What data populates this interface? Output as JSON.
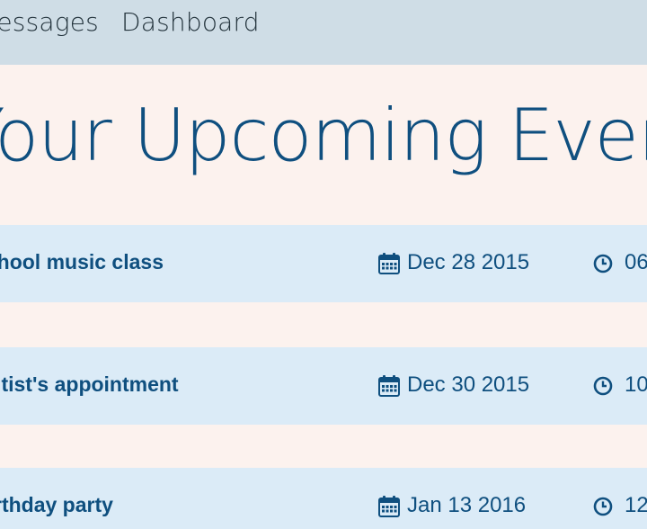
{
  "nav": {
    "messages_label": "Messages",
    "dashboard_label": "Dashboard"
  },
  "heading": "Your Upcoming Events",
  "events": [
    {
      "title": "After school music class",
      "date": "Dec 28 2015",
      "time": "06"
    },
    {
      "title": "Dentist's appointment",
      "date": "Dec 30 2015",
      "time": "10"
    },
    {
      "title": "Birthday party",
      "date": "Jan 13 2016",
      "time": "12"
    }
  ],
  "icons": {
    "date": "calendar-icon",
    "time": "clock-icon"
  },
  "colors": {
    "nav_bg": "#cfdde6",
    "page_bg": "#fcf2ee",
    "row_bg": "#dbebf7",
    "accent": "#0f4f7f"
  }
}
